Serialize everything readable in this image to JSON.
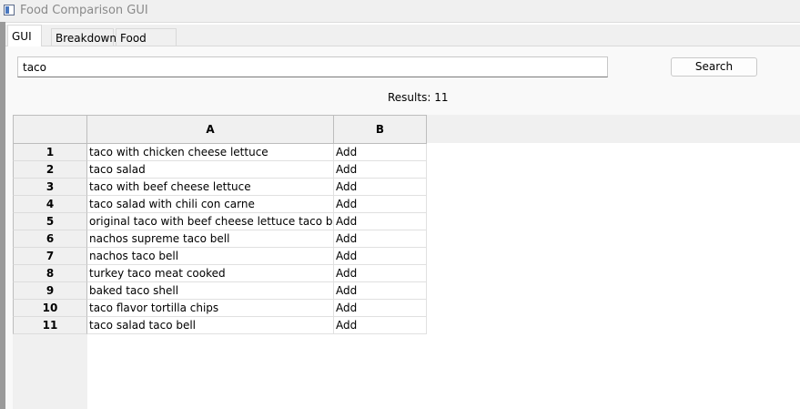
{
  "window": {
    "title": "Food Comparison GUI"
  },
  "tabs": [
    {
      "label": "GUI"
    },
    {
      "label": "Breakdown"
    },
    {
      "label": "Food Wars"
    }
  ],
  "search": {
    "value": "taco",
    "button_label": "Search"
  },
  "results_label": "Results: 11",
  "table": {
    "columns": [
      "A",
      "B"
    ],
    "rows": [
      {
        "num": "1",
        "a": "taco with chicken cheese lettuce",
        "b": "Add"
      },
      {
        "num": "2",
        "a": "taco salad",
        "b": "Add"
      },
      {
        "num": "3",
        "a": "taco with beef cheese lettuce",
        "b": "Add"
      },
      {
        "num": "4",
        "a": "taco salad with chili con carne",
        "b": "Add"
      },
      {
        "num": "5",
        "a": "original taco with beef cheese lettuce taco bell",
        "b": "Add"
      },
      {
        "num": "6",
        "a": "nachos supreme taco bell",
        "b": "Add"
      },
      {
        "num": "7",
        "a": "nachos taco bell",
        "b": "Add"
      },
      {
        "num": "8",
        "a": "turkey taco meat cooked",
        "b": "Add"
      },
      {
        "num": "9",
        "a": "baked taco shell",
        "b": "Add"
      },
      {
        "num": "10",
        "a": "taco flavor tortilla chips",
        "b": "Add"
      },
      {
        "num": "11",
        "a": "taco salad taco bell",
        "b": "Add"
      }
    ]
  }
}
